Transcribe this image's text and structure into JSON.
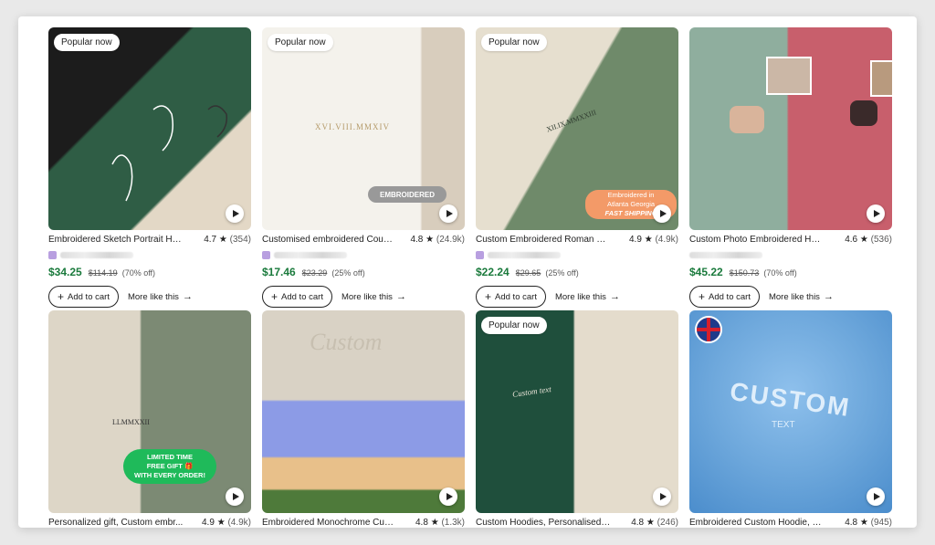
{
  "cards": [
    {
      "badge": "Popular now",
      "title": "Embroidered Sketch Portrait Ho...",
      "rating": "4.7",
      "count": "(354)",
      "price": "$34.25",
      "original": "$114.19",
      "discount": "(70% off)",
      "add_label": "Add to cart",
      "more_label": "More like this",
      "bg": [
        "#2f5d45",
        "#1c1c1c"
      ],
      "thumb_text": ""
    },
    {
      "badge": "Popular now",
      "title": "Customised embroidered Coupl...",
      "rating": "4.8",
      "count": "(24.9k)",
      "price": "$17.46",
      "original": "$23.29",
      "discount": "(25% off)",
      "add_label": "Add to cart",
      "more_label": "More like this",
      "bg": [
        "#f4f1ea",
        "#d8cdbd"
      ],
      "thumb_text": "XVI.VIII.MMXIV",
      "overlay": "EMBROIDERED"
    },
    {
      "badge": "Popular now",
      "title": "Custom Embroidered Roman Nu...",
      "rating": "4.9",
      "count": "(4.9k)",
      "price": "$22.24",
      "original": "$29.65",
      "discount": "(25% off)",
      "add_label": "Add to cart",
      "more_label": "More like this",
      "bg": [
        "#e6dfcf",
        "#6f8a6a"
      ],
      "thumb_text": "XII.IX.MMXXIII",
      "overlay_lines": [
        "Embroidered in",
        "Atlanta Georgia",
        "FAST SHIPPING"
      ]
    },
    {
      "badge": "",
      "title": "Custom Photo Embroidered Hoo...",
      "rating": "4.6",
      "count": "(536)",
      "price": "$45.22",
      "original": "$150.73",
      "discount": "(70% off)",
      "add_label": "Add to cart",
      "more_label": "More like this",
      "bg": [
        "#8fae9e",
        "#c85f6c"
      ],
      "thumb_text": ""
    },
    {
      "badge": "",
      "title": "Personalized gift, Custom embr...",
      "rating": "4.9",
      "count": "(4.9k)",
      "price": "",
      "original": "",
      "discount": "",
      "add_label": "",
      "more_label": "",
      "bg": [
        "#ddd6c7",
        "#7c8a74"
      ],
      "thumb_text": "LLMMXXII",
      "overlay_lines": [
        "LIMITED TIME",
        "FREE GIFT 🎁",
        "WITH EVERY ORDER!"
      ]
    },
    {
      "badge": "",
      "title": "Embroidered Monochrome Cust...",
      "rating": "4.8",
      "count": "(1.3k)",
      "price": "",
      "original": "",
      "discount": "",
      "add_label": "",
      "more_label": "",
      "bg": [
        "#d9d2c5",
        "#8c9be6",
        "#e8c08a"
      ],
      "thumb_text": "Custom"
    },
    {
      "badge": "Popular now",
      "title": "Custom Hoodies, Personalised N...",
      "rating": "4.8",
      "count": "(246)",
      "price": "",
      "original": "",
      "discount": "",
      "add_label": "",
      "more_label": "",
      "bg": [
        "#1f4f3c",
        "#e4dccc"
      ],
      "thumb_text": "Custom text"
    },
    {
      "badge": "",
      "title": "Embroidered Custom Hoodie, P...",
      "rating": "4.8",
      "count": "(945)",
      "price": "",
      "original": "",
      "discount": "",
      "add_label": "",
      "more_label": "",
      "bg": [
        "#6ea8dc",
        "#4b8dcc"
      ],
      "thumb_text": "CUSTOM",
      "thumb_sub": "TEXT"
    }
  ]
}
